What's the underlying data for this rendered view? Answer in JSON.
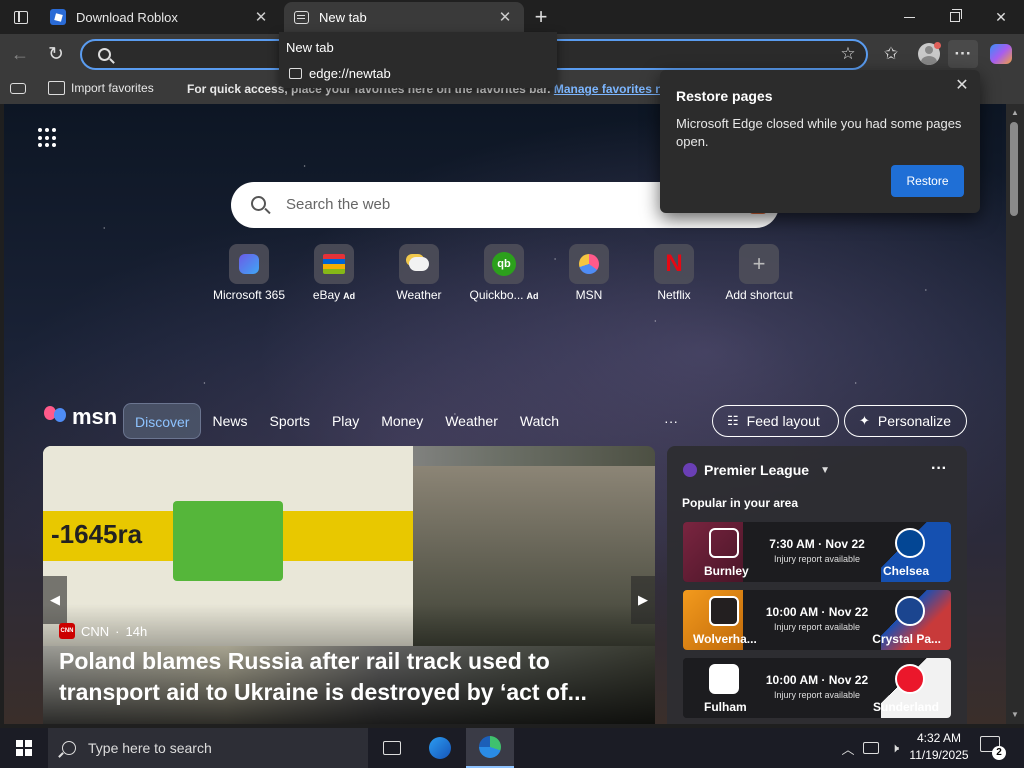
{
  "browser": {
    "tabs": [
      {
        "label": "Download Roblox",
        "favicon": "roblox-icon",
        "active": false
      },
      {
        "label": "New tab",
        "favicon": "newtab-icon",
        "active": true
      }
    ],
    "close_glyph": "✕",
    "new_tab_glyph": "+"
  },
  "toolbar": {
    "address_value": "",
    "address_placeholder": "",
    "back_glyph": "←",
    "refresh_glyph": "↻",
    "star_glyph": "☆",
    "favorites_glyph": "✩",
    "more_glyph": "···"
  },
  "favbar": {
    "import_label": "Import favorites",
    "hint_text": "For quick access, place your favorites here on the favorites bar.",
    "hint_link": "Manage favorites now"
  },
  "tab_tooltip": {
    "title": "New tab",
    "url": "edge://newtab"
  },
  "restore": {
    "title": "Restore pages",
    "message": "Microsoft Edge closed while you had some pages open.",
    "button": "Restore",
    "close_glyph": "✕"
  },
  "newtab": {
    "search_placeholder": "Search the web",
    "shortcuts": [
      {
        "name": "Microsoft 365",
        "ad": "",
        "icon": "m365-icon",
        "color": "#7b5be6"
      },
      {
        "name": "eBay",
        "ad": "Ad",
        "icon": "ebay-icon",
        "color": "#e53238"
      },
      {
        "name": "Weather",
        "ad": "",
        "icon": "weather-icon",
        "color": "#f2c94c"
      },
      {
        "name": "Quickbo...",
        "ad": "Ad",
        "icon": "quickbooks-icon",
        "color": "#2ca01c"
      },
      {
        "name": "MSN",
        "ad": "",
        "icon": "msn-icon",
        "color": "#4f8cf5"
      },
      {
        "name": "Netflix",
        "ad": "",
        "icon": "netflix-icon",
        "color": "#e50914"
      },
      {
        "name": "Add shortcut",
        "ad": "",
        "icon": "plus-icon",
        "color": "#aaaaaa"
      }
    ]
  },
  "msn": {
    "logo_text": "msn",
    "nav": [
      "Discover",
      "News",
      "Sports",
      "Play",
      "Money",
      "Weather",
      "Watch"
    ],
    "active_nav": "Discover",
    "more_glyph": "···",
    "feed_layout": "Feed layout",
    "personalize": "Personalize"
  },
  "hero": {
    "source": "CNN",
    "age": "14h",
    "headline": "Poland blames Russia after rail track used to transport aid to Ukraine is destroyed by ‘act of...",
    "train_number": "-1645ra"
  },
  "sports": {
    "league": "Premier League",
    "subtitle": "Popular in your area",
    "matches": [
      {
        "home": "Burnley",
        "away": "Chelsea",
        "time": "7:30 AM · Nov 22",
        "note": "Injury report available"
      },
      {
        "home": "Wolverha...",
        "away": "Crystal Pa...",
        "time": "10:00 AM · Nov 22",
        "note": "Injury report available"
      },
      {
        "home": "Fulham",
        "away": "Sunderland",
        "time": "10:00 AM · Nov 22",
        "note": "Injury report available"
      }
    ]
  },
  "taskbar": {
    "search_placeholder": "Type here to search",
    "time": "4:32 AM",
    "date": "11/19/2025",
    "notifications": "2"
  }
}
